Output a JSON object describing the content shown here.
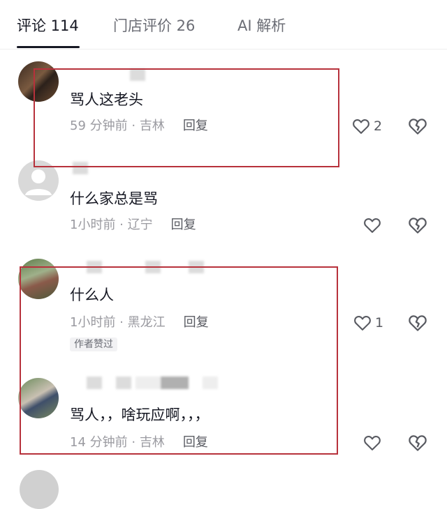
{
  "tabs": [
    {
      "label": "评论 114",
      "active": true
    },
    {
      "label": "门店评价 26",
      "active": false
    },
    {
      "label": "AI 解析",
      "active": false
    }
  ],
  "comments": [
    {
      "text": "骂人这老头",
      "time": "59 分钟前",
      "location": "吉林",
      "reply": "回复",
      "likes": "2"
    },
    {
      "text": "什么家总是骂",
      "time": "1小时前",
      "location": "辽宁",
      "reply": "回复",
      "likes": ""
    },
    {
      "text": "什么人",
      "time": "1小时前",
      "location": "黑龙江",
      "reply": "回复",
      "likes": "1",
      "badge": "作者赞过"
    },
    {
      "text": "骂人，，啥玩应啊，，，",
      "time": "14 分钟前",
      "location": "吉林",
      "reply": "回复",
      "likes": ""
    }
  ],
  "meta_separator": " · ",
  "icons": {
    "like": "heart-outline-icon",
    "dislike": "broken-heart-icon"
  },
  "colors": {
    "annotation_box": "#b7313b",
    "text": "#161823",
    "meta": "#9a9aa0"
  }
}
